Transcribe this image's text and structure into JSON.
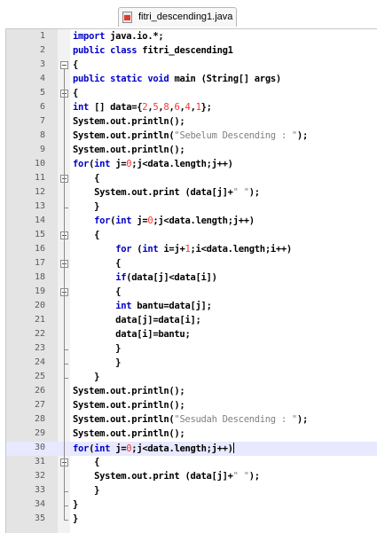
{
  "tab": {
    "icon": "java-file-icon",
    "label": "fitri_descending1.java"
  },
  "editor": {
    "current_line": 30,
    "lines": [
      {
        "n": "1",
        "text": "import java.io.*;"
      },
      {
        "n": "2",
        "text": "public class fitri_descending1"
      },
      {
        "n": "3",
        "text": "{"
      },
      {
        "n": "4",
        "text": "public static void main (String[] args)"
      },
      {
        "n": "5",
        "text": "{"
      },
      {
        "n": "6",
        "text": "int [] data={2,5,8,6,4,1};"
      },
      {
        "n": "7",
        "text": "System.out.println();"
      },
      {
        "n": "8",
        "text": "System.out.println(\"Sebelum Descending : \");"
      },
      {
        "n": "9",
        "text": "System.out.println();"
      },
      {
        "n": "10",
        "text": "for(int j=0;j<data.length;j++)"
      },
      {
        "n": "11",
        "text": "    {"
      },
      {
        "n": "12",
        "text": "    System.out.print (data[j]+\" \");"
      },
      {
        "n": "13",
        "text": "    }"
      },
      {
        "n": "14",
        "text": "    for(int j=0;j<data.length;j++)"
      },
      {
        "n": "15",
        "text": "    {"
      },
      {
        "n": "16",
        "text": "        for (int i=j+1;i<data.length;i++)"
      },
      {
        "n": "17",
        "text": "        {"
      },
      {
        "n": "18",
        "text": "        if(data[j]<data[i])"
      },
      {
        "n": "19",
        "text": "        {"
      },
      {
        "n": "20",
        "text": "        int bantu=data[j];"
      },
      {
        "n": "21",
        "text": "        data[j]=data[i];"
      },
      {
        "n": "22",
        "text": "        data[i]=bantu;"
      },
      {
        "n": "23",
        "text": "        }"
      },
      {
        "n": "24",
        "text": "        }"
      },
      {
        "n": "25",
        "text": "    }"
      },
      {
        "n": "26",
        "text": "System.out.println();"
      },
      {
        "n": "27",
        "text": "System.out.println();"
      },
      {
        "n": "28",
        "text": "System.out.println(\"Sesudah Descending : \");"
      },
      {
        "n": "29",
        "text": "System.out.println();"
      },
      {
        "n": "30",
        "text": "for(int j=0;j<data.length;j++)"
      },
      {
        "n": "31",
        "text": "    {"
      },
      {
        "n": "32",
        "text": "    System.out.print (data[j]+\" \");"
      },
      {
        "n": "33",
        "text": "    }"
      },
      {
        "n": "34",
        "text": "}"
      },
      {
        "n": "35",
        "text": "}"
      }
    ],
    "fold_markers": [
      3,
      5,
      11,
      15,
      17,
      19,
      31
    ]
  },
  "colors": {
    "keyword": "#0000c8",
    "number": "#ff3030",
    "string": "#808080",
    "current_line_bg": "#e8e8ff",
    "gutter_bg": "#e4e4e4"
  }
}
